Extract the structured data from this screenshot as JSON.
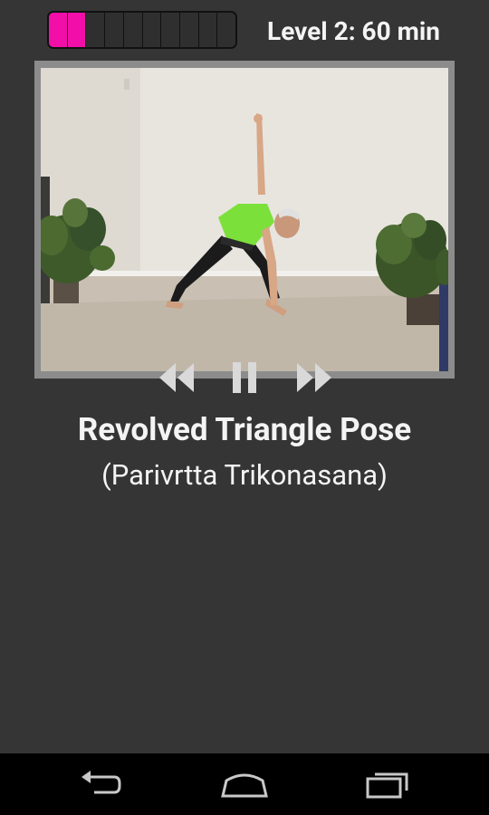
{
  "header": {
    "progress": {
      "filled_segments": 2,
      "total_segments": 10,
      "fill_color": "#f20ea9"
    },
    "level_label": "Level 2: 60 min"
  },
  "video": {
    "controls": {
      "rewind_icon": "rewind-icon",
      "pause_icon": "pause-icon",
      "forward_icon": "fast-forward-icon"
    }
  },
  "pose": {
    "name": "Revolved Triangle Pose",
    "sanskrit": "(Parivrtta Trikonasana)"
  },
  "navbar": {
    "back_icon": "back-icon",
    "home_icon": "home-icon",
    "recents_icon": "recent-apps-icon"
  },
  "colors": {
    "background": "#353535",
    "accent": "#f20ea9",
    "navbar": "#000000"
  }
}
